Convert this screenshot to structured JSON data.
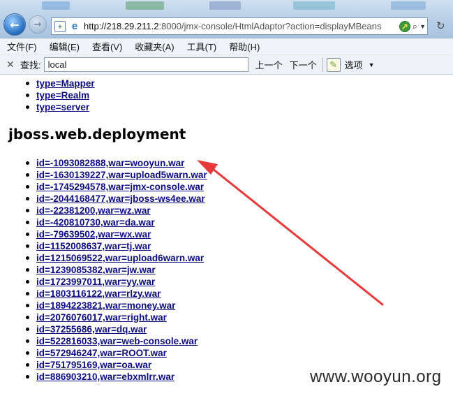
{
  "browser": {
    "url_host": "http://218.29.211.2",
    "url_path": ":8000/jmx-console/HtmlAdaptor?action=displayMBeans",
    "icons": [
      "back-icon",
      "forward-icon",
      "add-tab-icon",
      "ie-logo-icon",
      "compat-view-icon",
      "search-icon",
      "dropdown-icon",
      "refresh-icon"
    ]
  },
  "menu": {
    "items": [
      "文件(F)",
      "编辑(E)",
      "查看(V)",
      "收藏夹(A)",
      "工具(T)",
      "帮助(H)"
    ]
  },
  "find_bar": {
    "label": "查找:",
    "value": "local",
    "prev_label": "上一个",
    "next_label": "下一个",
    "options_label": "选项"
  },
  "content": {
    "top_links": [
      "type=Mapper",
      "type=Realm",
      "type=server"
    ],
    "section_title": "jboss.web.deployment",
    "deployments": [
      "id=-1093082888,war=wooyun.war",
      "id=-1630139227,war=upload5warn.war",
      "id=-1745294578,war=jmx-console.war",
      "id=-2044168477,war=jboss-ws4ee.war",
      "id=-22381200,war=wz.war",
      "id=-420810730,war=da.war",
      "id=-79639502,war=wx.war",
      "id=1152008637,war=tj.war",
      "id=1215069522,war=upload6warn.war",
      "id=1239085382,war=jw.war",
      "id=1723997011,war=yy.war",
      "id=1803116122,war=rlzy.war",
      "id=1894223821,war=money.war",
      "id=2076076017,war=right.war",
      "id=37255686,war=dq.war",
      "id=522816033,war=web-console.war",
      "id=572946247,war=ROOT.war",
      "id=751795169,war=oa.war",
      "id=886903210,war=ebxmlrr.war"
    ]
  },
  "annotation": {
    "arrow_color": "#e8383a"
  },
  "watermark": "www.wooyun.org"
}
